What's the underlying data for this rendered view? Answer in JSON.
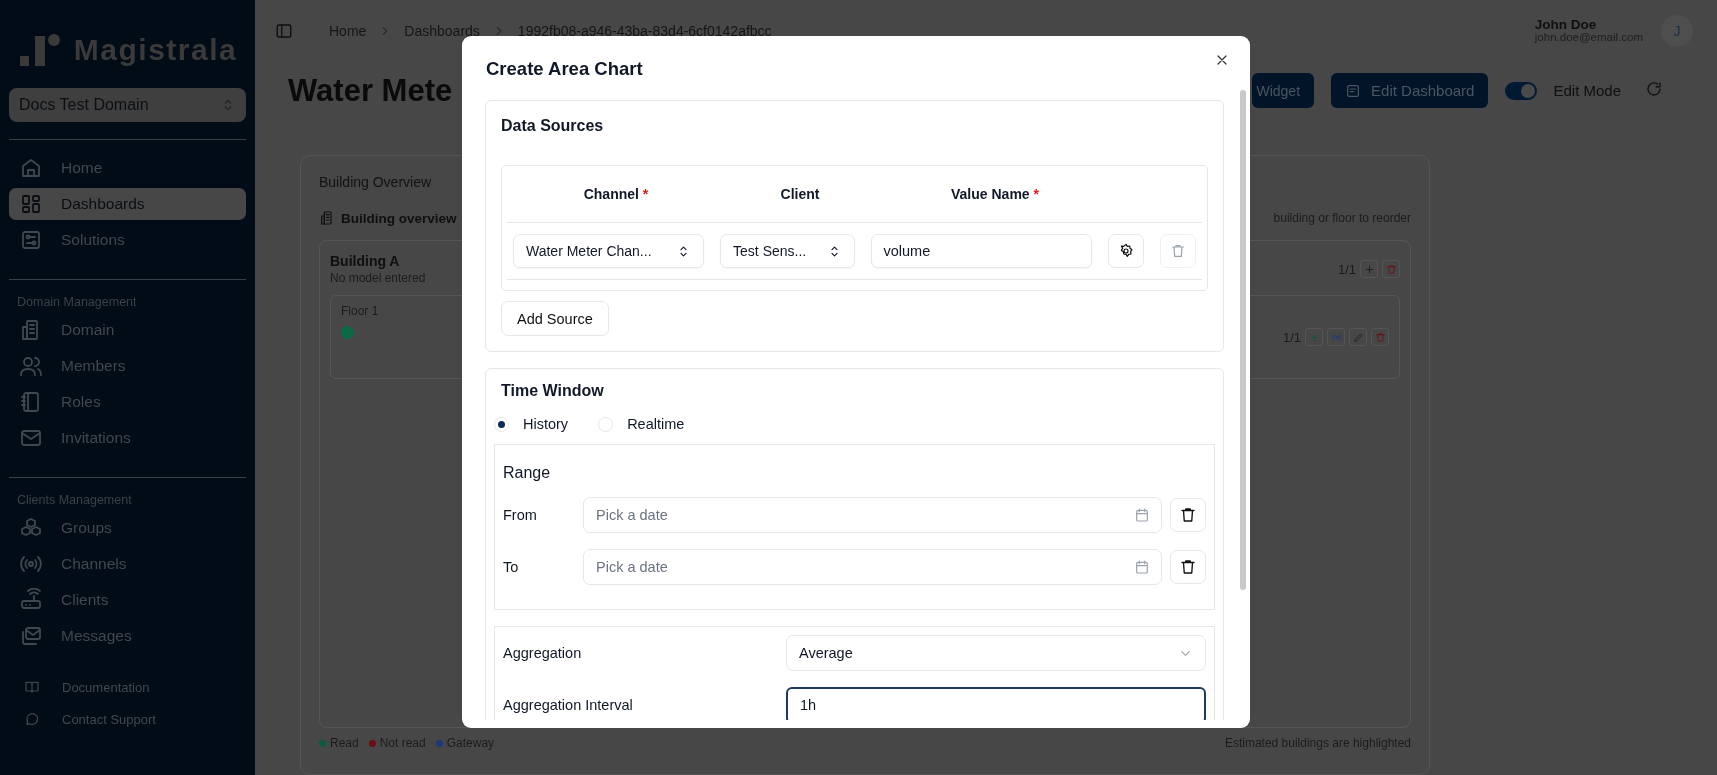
{
  "sidebar": {
    "logo_text": "Magistrala",
    "domain": "Docs Test Domain",
    "groups": [
      {
        "items": [
          {
            "label": "Home",
            "selected": false
          },
          {
            "label": "Dashboards",
            "selected": true
          },
          {
            "label": "Solutions",
            "selected": false
          }
        ]
      },
      {
        "heading": "Domain Management",
        "items": [
          {
            "label": "Domain",
            "selected": false
          },
          {
            "label": "Members",
            "selected": false
          },
          {
            "label": "Roles",
            "selected": false
          },
          {
            "label": "Invitations",
            "selected": false
          }
        ]
      },
      {
        "heading": "Clients Management",
        "items": [
          {
            "label": "Groups",
            "selected": false
          },
          {
            "label": "Channels",
            "selected": false
          },
          {
            "label": "Clients",
            "selected": false
          },
          {
            "label": "Messages",
            "selected": false
          }
        ]
      }
    ],
    "footer_links": [
      "Documentation",
      "Contact Support"
    ]
  },
  "header": {
    "breadcrumbs": [
      "Home",
      "Dashboards",
      "1992fb08-a946-43ba-83d4-6cf0142afbcc"
    ],
    "user": {
      "name": "John Doe",
      "email": "john.doe@email.com",
      "avatar_initial": "J"
    }
  },
  "toolbar": {
    "title": "Water Mete",
    "buttons": [
      "Widget",
      "Edit Dashboard"
    ],
    "edit_mode": {
      "label": "Edit Mode",
      "on": true
    }
  },
  "overview": {
    "title": "Building Overview",
    "subtitle": "Building overview",
    "hint": "building or floor to reorder",
    "building": {
      "name": "Building A",
      "model": "No model entered",
      "count": "1/1",
      "floors": [
        {
          "name": "Floor 1",
          "count": "1/1",
          "color": "#0a6a45"
        }
      ]
    },
    "legend": [
      {
        "label": "Read",
        "color": "#0b5a3a"
      },
      {
        "label": "Not read",
        "color": "#6a0f14"
      },
      {
        "label": "Gateway",
        "color": "#1a3a7a"
      }
    ],
    "note": "Estimated buildings are highlighted"
  },
  "dialog": {
    "title": "Create Area Chart",
    "data_sources": {
      "title": "Data Sources",
      "columns": [
        {
          "label": "Channel",
          "required_mark": "*"
        },
        {
          "label": "Client"
        },
        {
          "label": "Value Name",
          "required_mark": "*"
        }
      ],
      "rows": [
        {
          "channel": "Water Meter Chan...",
          "client": "Test Sens...",
          "value_name": "volume",
          "delete_disabled": true
        }
      ],
      "add_button": "Add Source"
    },
    "time_window": {
      "title": "Time Window",
      "modes": [
        {
          "label": "History",
          "selected": true
        },
        {
          "label": "Realtime",
          "selected": false
        }
      ],
      "range": {
        "title": "Range",
        "fields": [
          {
            "label": "From",
            "placeholder": "Pick a date"
          },
          {
            "label": "To",
            "placeholder": "Pick a date"
          }
        ]
      },
      "aggregation": {
        "label": "Aggregation",
        "value": "Average"
      },
      "interval": {
        "label": "Aggregation Interval",
        "value": "1h",
        "focused": true
      }
    }
  }
}
